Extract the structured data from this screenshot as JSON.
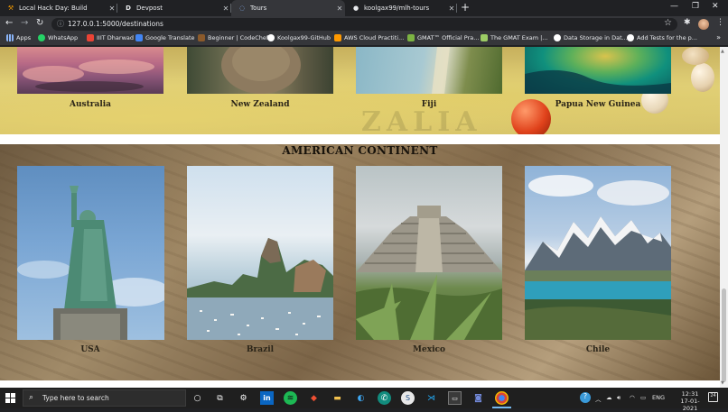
{
  "browser": {
    "tabs": [
      {
        "label": "Local Hack Day: Build",
        "icon": "hammer-icon",
        "active": false
      },
      {
        "label": "Devpost",
        "icon": "devpost-icon",
        "active": false
      },
      {
        "label": "Tours",
        "icon": "globe-icon",
        "active": true
      },
      {
        "label": "koolgax99/mlh-tours",
        "icon": "github-icon",
        "active": false
      }
    ],
    "url": "127.0.0.1:5000/destinations",
    "bookmarks": [
      {
        "label": "Apps",
        "icon": "apps-grid-icon",
        "color": "#4285f4"
      },
      {
        "label": "WhatsApp",
        "icon": "whatsapp-icon",
        "color": "#25d366"
      },
      {
        "label": "IIIT Dharwad",
        "icon": "gmail-icon",
        "color": "#ea4335"
      },
      {
        "label": "Google Translate",
        "icon": "translate-icon",
        "color": "#4285f4"
      },
      {
        "label": "Beginner | CodeChef",
        "icon": "codechef-icon",
        "color": "#8b5a2b"
      },
      {
        "label": "Koolgax99-GitHub",
        "icon": "github-icon",
        "color": "#ffffff"
      },
      {
        "label": "AWS Cloud Practiti...",
        "icon": "aws-icon",
        "color": "#f90"
      },
      {
        "label": "GMAT™ Official Pra...",
        "icon": "gmat-icon",
        "color": "#7cb342"
      },
      {
        "label": "The GMAT Exam |...",
        "icon": "gmat-icon",
        "color": "#9ccc65"
      },
      {
        "label": "Data Storage in Dat...",
        "icon": "github-icon",
        "color": "#ffffff"
      },
      {
        "label": "Add Tests for the p...",
        "icon": "github-icon",
        "color": "#ffffff"
      }
    ]
  },
  "page": {
    "oceania": {
      "cards": [
        {
          "name": "Australia",
          "image": "sunset-sky-photo"
        },
        {
          "name": "New Zealand",
          "image": "kiwi-bird-photo"
        },
        {
          "name": "Fiji",
          "image": "fiji-coast-aerial-photo"
        },
        {
          "name": "Papua New Guinea",
          "image": "reef-island-aerial-photo"
        }
      ]
    },
    "american": {
      "title": "AMERICAN CONTINENT",
      "cards": [
        {
          "name": "USA",
          "image": "statue-of-liberty-photo"
        },
        {
          "name": "Brazil",
          "image": "sugarloaf-mountain-photo"
        },
        {
          "name": "Mexico",
          "image": "chichen-itza-pyramid-photo"
        },
        {
          "name": "Chile",
          "image": "torres-del-paine-photo"
        }
      ]
    }
  },
  "taskbar": {
    "search_placeholder": "Type here to search",
    "apps": [
      "cortana-icon",
      "task-view-icon",
      "settings-icon",
      "linkedin-icon",
      "spotify-icon",
      "git-icon",
      "file-explorer-icon",
      "edge-icon",
      "whatsapp-icon",
      "simplenote-icon",
      "vscode-icon",
      "terminal-icon",
      "discord-icon",
      "chrome-icon"
    ],
    "language": "ENG",
    "time": "12:31",
    "date": "17-01-2021",
    "notifications": "24"
  }
}
